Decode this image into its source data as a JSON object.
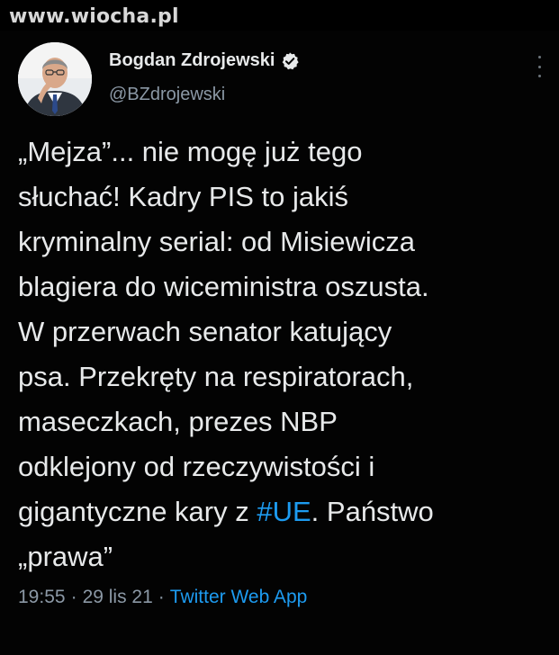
{
  "watermark": "www.wiocha.pl",
  "tweet": {
    "author": {
      "display_name": "Bogdan Zdrojewski",
      "handle": "@BZdrojewski",
      "verified": true,
      "verified_icon": "verified-badge-icon"
    },
    "text_lines": [
      "„Mejza”... nie mogę już tego",
      "słuchać! Kadry PIS to jakiś",
      "kryminalny serial: od Misiewicza",
      "blagiera do wiceministra oszusta.",
      "W przerwach senator katujący",
      "psa. Przekręty na respiratorach,",
      "maseczkach, prezes NBP",
      "odklejony od rzeczywistości i",
      {
        "before": "gigantyczne kary z ",
        "hashtag": "#UE",
        "after": ". Państwo"
      },
      "„prawa”"
    ],
    "time": "19:55",
    "date": "29 lis 21",
    "separator": "·",
    "source": "Twitter Web App"
  },
  "colors": {
    "background": "#000000",
    "text": "#e7e9ea",
    "secondary": "#8b98a5",
    "accent": "#1d9bf0"
  }
}
